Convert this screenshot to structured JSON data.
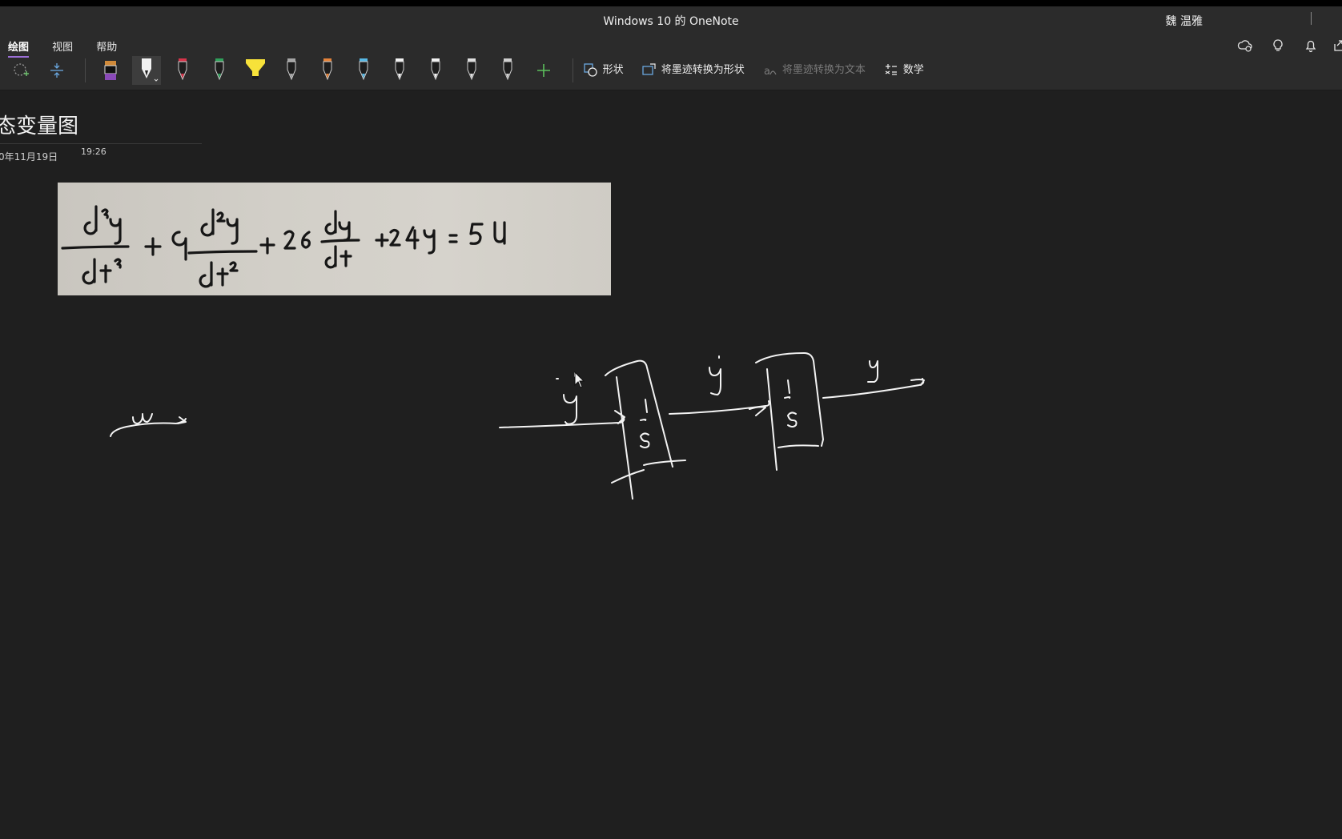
{
  "window": {
    "title": "Windows 10 的 OneNote",
    "user": "魏 温雅"
  },
  "ribbon": {
    "tabs": [
      {
        "label": "绘图",
        "active": true
      },
      {
        "label": "视图",
        "active": false
      },
      {
        "label": "帮助",
        "active": false
      }
    ],
    "buttons": {
      "shapes": "形状",
      "ink_to_shape": "将墨迹转换为形状",
      "ink_to_text": "将墨迹转换为文本",
      "math": "数学"
    },
    "right_icons": [
      "cloud-sync-icon",
      "lightbulb-icon",
      "bell-icon",
      "share-icon"
    ]
  },
  "page": {
    "title": "态变量图",
    "date": "0年11月19日",
    "time": "19:26"
  },
  "accent_color": "#9b6fd6"
}
